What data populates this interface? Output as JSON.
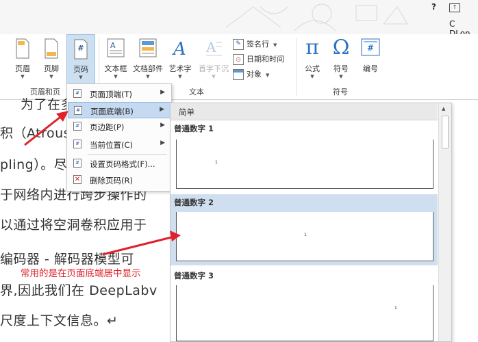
{
  "titlebar": {
    "help": "?",
    "user": "C DLon"
  },
  "ribbon": {
    "buttons": {
      "header": "页眉",
      "footer": "页脚",
      "page_number": "页码",
      "textbox": "文本框",
      "quick_parts": "文档部件",
      "wordart": "艺术字",
      "drop_cap": "首字下沉",
      "equation": "公式",
      "symbol": "符号",
      "numbering": "编号"
    },
    "small_buttons": {
      "signature_line": "签名行",
      "date_time": "日期和时间",
      "object": "对象"
    },
    "groups": {
      "header_footer": "页眉和页",
      "text": "文本",
      "symbols": "符号"
    },
    "icon_glyphs": {
      "page_number": "#",
      "equation": "π",
      "symbol": "Ω",
      "numbering": "#"
    }
  },
  "page_number_menu": {
    "items": [
      {
        "label": "页面顶端(T)"
      },
      {
        "label": "页面底端(B)"
      },
      {
        "label": "页边距(P)"
      },
      {
        "label": "当前位置(C)"
      },
      {
        "label": "设置页码格式(F)..."
      },
      {
        "label": "删除页码(R)"
      }
    ]
  },
  "gallery": {
    "header": "简单",
    "items": [
      {
        "title": "普通数字 1",
        "number": "1"
      },
      {
        "title": "普通数字 2",
        "number": "1"
      },
      {
        "title": "普通数字 3",
        "number": "1"
      }
    ]
  },
  "document": {
    "lines": [
      "为了在多",
      "积（Atrous C",
      "pling）。尽",
      "于网络内进行跨步操作的",
      "以通过将空洞卷积应用于",
      "编码器 - 解码器模型可",
      "界,因此我们在 DeepLabv",
      "尺度上下文信息。↵"
    ]
  },
  "annotation": {
    "text": "常用的是在页面底端居中显示",
    "color": "#e0202a"
  }
}
